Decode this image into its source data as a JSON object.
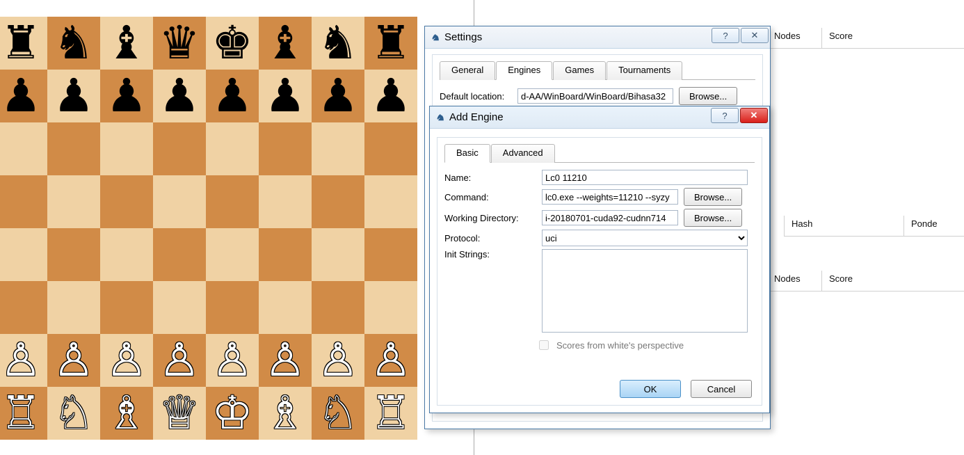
{
  "columns": {
    "nodes": "Nodes",
    "score": "Score",
    "hash": "Hash",
    "ponder": "Ponde"
  },
  "settings": {
    "title": "Settings",
    "tabs": {
      "general": "General",
      "engines": "Engines",
      "games": "Games",
      "tournaments": "Tournaments"
    },
    "default_location_label": "Default location:",
    "default_location_value": "d-AA/WinBoard/WinBoard/Bihasa32",
    "browse": "Browse..."
  },
  "addengine": {
    "title": "Add Engine",
    "tabs": {
      "basic": "Basic",
      "advanced": "Advanced"
    },
    "name_label": "Name:",
    "name_value": "Lc0 11210",
    "command_label": "Command:",
    "command_value": "lc0.exe --weights=11210 --syzy",
    "workdir_label": "Working Directory:",
    "workdir_value": "i-20180701-cuda92-cudnn714",
    "protocol_label": "Protocol:",
    "protocol_value": "uci",
    "init_label": "Init Strings:",
    "init_value": "",
    "scores_checkbox": "Scores from white's perspective",
    "browse": "Browse...",
    "ok": "OK",
    "cancel": "Cancel"
  },
  "board": {
    "rows": [
      [
        "r",
        "n",
        "b",
        "q",
        "k",
        "b",
        "n",
        "r"
      ],
      [
        "p",
        "p",
        "p",
        "p",
        "p",
        "p",
        "p",
        "p"
      ],
      [
        ".",
        ".",
        ".",
        ".",
        ".",
        ".",
        ".",
        "."
      ],
      [
        ".",
        ".",
        ".",
        ".",
        ".",
        ".",
        ".",
        "."
      ],
      [
        ".",
        ".",
        ".",
        ".",
        ".",
        ".",
        ".",
        "."
      ],
      [
        ".",
        ".",
        ".",
        ".",
        ".",
        ".",
        ".",
        "."
      ],
      [
        "P",
        "P",
        "P",
        "P",
        "P",
        "P",
        "P",
        "P"
      ],
      [
        "R",
        "N",
        "B",
        "Q",
        "K",
        "B",
        "N",
        "R"
      ]
    ]
  }
}
